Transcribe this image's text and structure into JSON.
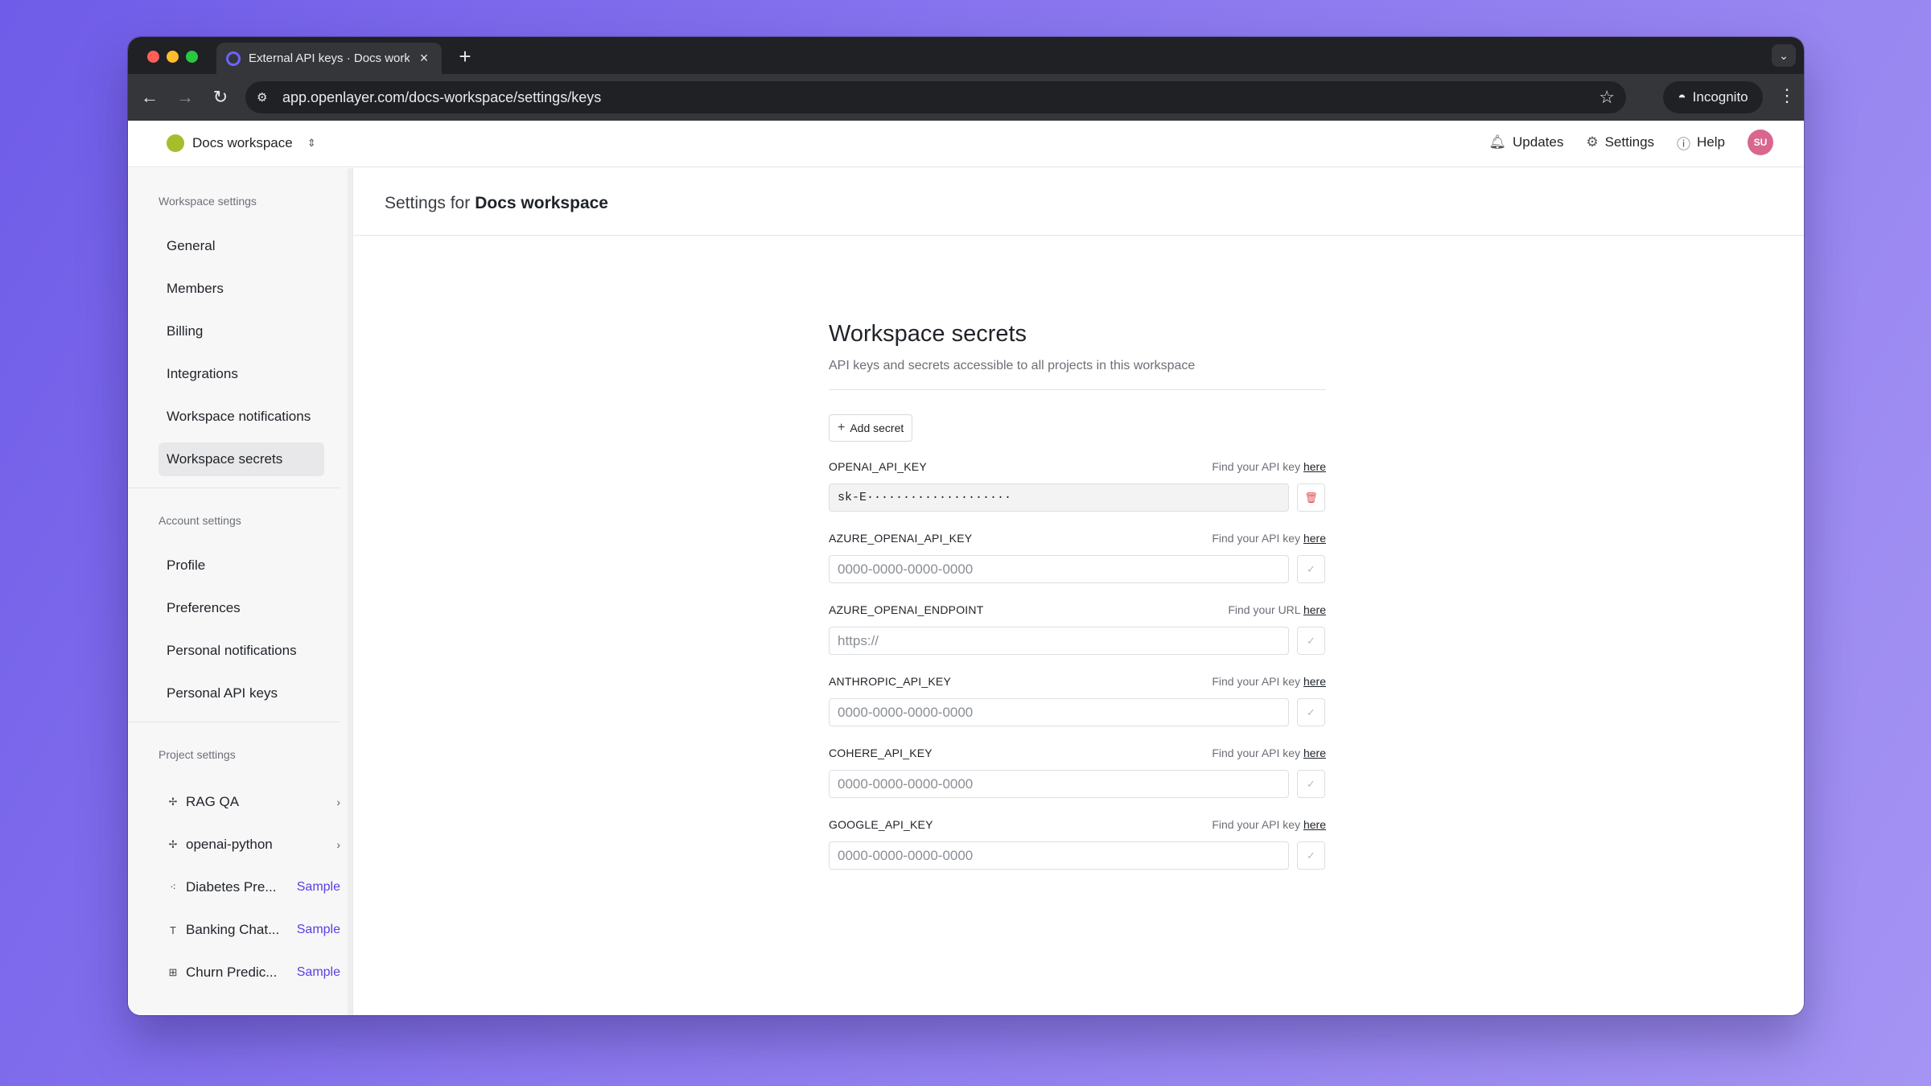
{
  "browser": {
    "tab_title": "External API keys · Docs workspace",
    "tab_close": "×",
    "new_tab": "+",
    "tab_search": "⌄",
    "url": "app.openlayer.com/docs-workspace/settings/keys",
    "incognito_label": "Incognito",
    "icons": {
      "back": "arrow-left-icon",
      "forward": "arrow-right-icon",
      "reload": "reload-icon",
      "site_info": "tune-icon",
      "bookmark": "star-icon",
      "incognito": "incognito-icon",
      "menu": "kebab-icon"
    }
  },
  "topbar": {
    "workspace_name": "Docs workspace",
    "workspace_color": "#a7be2c",
    "updates_label": "Updates",
    "settings_label": "Settings",
    "help_label": "Help",
    "avatar_initials": "SU",
    "avatar_color": "#d9668f"
  },
  "sidebar": {
    "workspace_settings_title": "Workspace settings",
    "workspace_items": [
      {
        "label": "General"
      },
      {
        "label": "Members"
      },
      {
        "label": "Billing"
      },
      {
        "label": "Integrations"
      },
      {
        "label": "Workspace notifications"
      },
      {
        "label": "Workspace secrets",
        "active": true
      }
    ],
    "account_settings_title": "Account settings",
    "account_items": [
      {
        "label": "Profile"
      },
      {
        "label": "Preferences"
      },
      {
        "label": "Personal notifications"
      },
      {
        "label": "Personal API keys"
      }
    ],
    "project_settings_title": "Project settings",
    "projects": [
      {
        "name": "RAG QA",
        "icon": "sparkle-icon"
      },
      {
        "name": "openai-python",
        "icon": "sparkle-icon"
      },
      {
        "name": "Diabetes Pre...",
        "icon": "scatter-icon",
        "badge": "Sample"
      },
      {
        "name": "Banking Chat...",
        "icon": "text-icon",
        "badge": "Sample"
      },
      {
        "name": "Churn Predic...",
        "icon": "table-icon",
        "badge": "Sample"
      }
    ]
  },
  "main": {
    "settings_for_label": "Settings for",
    "workspace_name": "Docs workspace",
    "title": "Workspace secrets",
    "description": "API keys and secrets accessible to all projects in this workspace",
    "add_secret_label": "Add secret",
    "here_link": "here",
    "secrets": [
      {
        "name": "OPENAI_API_KEY",
        "hint": "Find your API key",
        "value": "sk-E····················",
        "placeholder": "",
        "action": "delete-icon"
      },
      {
        "name": "AZURE_OPENAI_API_KEY",
        "hint": "Find your API key",
        "value": "",
        "placeholder": "0000-0000-0000-0000",
        "action": "check-icon"
      },
      {
        "name": "AZURE_OPENAI_ENDPOINT",
        "hint": "Find your URL",
        "value": "",
        "placeholder": "https://",
        "action": "check-icon"
      },
      {
        "name": "ANTHROPIC_API_KEY",
        "hint": "Find your API key",
        "value": "",
        "placeholder": "0000-0000-0000-0000",
        "action": "check-icon"
      },
      {
        "name": "COHERE_API_KEY",
        "hint": "Find your API key",
        "value": "",
        "placeholder": "0000-0000-0000-0000",
        "action": "check-icon"
      },
      {
        "name": "GOOGLE_API_KEY",
        "hint": "Find your API key",
        "value": "",
        "placeholder": "0000-0000-0000-0000",
        "action": "check-icon"
      }
    ]
  }
}
